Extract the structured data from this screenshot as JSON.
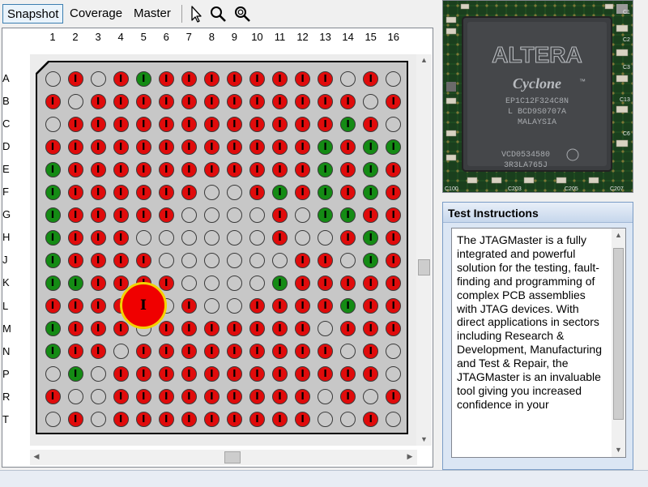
{
  "toolbar": {
    "tabs": [
      {
        "label": "Snapshot",
        "active": true
      },
      {
        "label": "Coverage",
        "active": false
      },
      {
        "label": "Master",
        "active": false
      }
    ],
    "tools": [
      "pointer-icon",
      "zoom-icon",
      "zoom-fit-icon"
    ]
  },
  "grid": {
    "columns": [
      "1",
      "2",
      "3",
      "4",
      "5",
      "6",
      "7",
      "8",
      "9",
      "10",
      "11",
      "12",
      "13",
      "14",
      "15",
      "16"
    ],
    "rows": [
      "A",
      "B",
      "C",
      "D",
      "E",
      "F",
      "G",
      "H",
      "J",
      "K",
      "L",
      "M",
      "N",
      "P",
      "R",
      "T"
    ],
    "pattern": [
      "nrnrgrrrrrrrrnrn",
      "rnrrrrrrrrrrrrnr",
      "nrrrrrrrrrrrrgrn",
      "rrrrrrrrrrrrgrgg",
      "grrrrrrrrrrrgrgr",
      "grrrrrrnnrgrgrgr",
      "grrrrrnnnnrnggrr",
      "grrrnnnnnnrnnrgr",
      "grrrrnnnnnnrrngr",
      "ggrrrrnnnngrrrrr",
      "rrrrrnrnnrrrrgrr",
      "grrrnrrrrrrrnrrr",
      "grrnrrrrrrrrrnrn",
      "ngnrrrrrrrrrrrrn",
      "rnnrrrrrrrrrnrnr",
      "nrnrrrrrrrrrnnrn"
    ],
    "pin_marker": "I",
    "highlight_marker": "I"
  },
  "photo": {
    "brand": "ALTERA",
    "family": "Cyclone",
    "family_mark": "™",
    "lines": [
      "EP1C12F324C8N",
      "L BCD9S0707A",
      "MALAYSIA",
      "VCD0534580",
      "3R3LA765J"
    ],
    "labels": [
      "C1",
      "C2",
      "C3",
      "C13",
      "C6",
      "C100",
      "C203",
      "C205",
      "C207"
    ]
  },
  "instructions": {
    "title": "Test Instructions",
    "text": "The JTAGMaster is a fully integrated and powerful solution for the testing, fault-finding and programming of complex PCB assemblies with JTAG devices. With direct applications in sectors including Research & Development, Manufacturing and Test & Repair, the JTAGMaster is an invaluable tool giving you increased confidence in your"
  },
  "colors": {
    "red": "#e00b0b",
    "green": "#148b14",
    "none": "#c9c9c9",
    "marker": "#f00000",
    "marker_border": "#f4d200"
  }
}
